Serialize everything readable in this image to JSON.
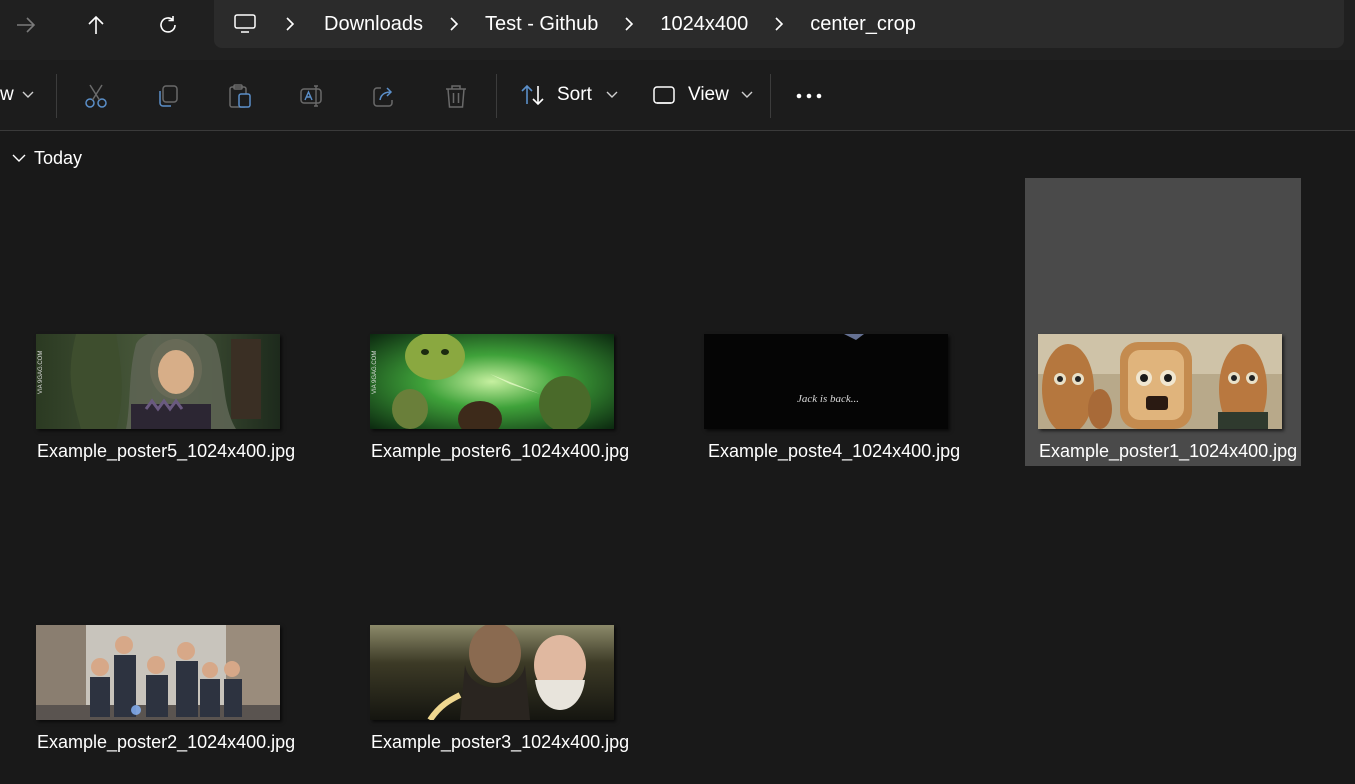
{
  "nav": {
    "forward": "forward-arrow-icon",
    "up": "up-arrow-icon",
    "refresh": "refresh-icon"
  },
  "breadcrumb": {
    "root_icon": "this-pc-icon",
    "items": [
      "Downloads",
      "Test - Github",
      "1024x400",
      "center_crop"
    ]
  },
  "toolbar": {
    "new_label_partial": "w",
    "actions": [
      "cut-icon",
      "copy-icon",
      "paste-icon",
      "rename-icon",
      "share-icon",
      "delete-icon"
    ],
    "sort_label": "Sort",
    "view_label": "View",
    "more": "more-options-icon"
  },
  "group": {
    "label": "Today"
  },
  "files": [
    {
      "name": "Example_poster5_1024x400.jpg",
      "selected": false
    },
    {
      "name": "Example_poster6_1024x400.jpg",
      "selected": false
    },
    {
      "name": "Example_poste4_1024x400.jpg",
      "selected": false
    },
    {
      "name": "Example_poster1_1024x400.jpg",
      "selected": true
    },
    {
      "name": "Example_poster2_1024x400.jpg",
      "selected": false
    },
    {
      "name": "Example_poster3_1024x400.jpg",
      "selected": false
    }
  ],
  "thumb_captions": {
    "poster4": "Jack is back..."
  },
  "colors": {
    "background": "#191919",
    "topbar": "#202020",
    "address_bar": "#2b2b2b",
    "selection": "#4a4a4a",
    "accent": "#5aa0e6"
  }
}
